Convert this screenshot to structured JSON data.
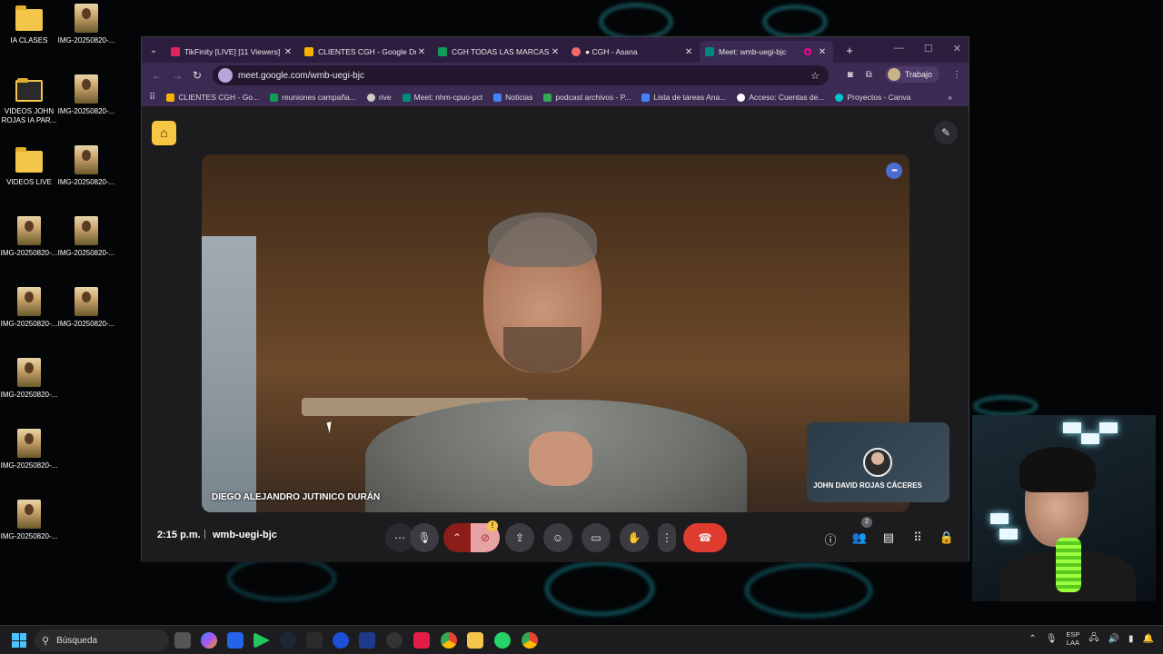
{
  "desktop": {
    "icons": [
      {
        "label": "IA CLASES",
        "type": "folder"
      },
      {
        "label": "IMG-20250820-...",
        "type": "image"
      },
      {
        "label": "VIDEOS JOHN ROJAS IA PAR...",
        "type": "folder-dark"
      },
      {
        "label": "IMG-20250820-...",
        "type": "image"
      },
      {
        "label": "VIDEOS LIVE",
        "type": "folder"
      },
      {
        "label": "IMG-20250820-...",
        "type": "image"
      },
      {
        "label": "IMG-20250820-...",
        "type": "image"
      },
      {
        "label": "IMG-20250820-...",
        "type": "image"
      },
      {
        "label": "IMG-20250820-...",
        "type": "image"
      },
      {
        "label": "IMG-20250820-...",
        "type": "image"
      },
      {
        "label": "IMG-20250820-...",
        "type": "image"
      },
      {
        "label": "IMG-20250820-...",
        "type": "image"
      },
      {
        "label": "IMG-20250820-...",
        "type": "image"
      }
    ]
  },
  "browser": {
    "tabs": [
      {
        "label": "TikFinity [LIVE] [11 Viewers]",
        "favicon_color": "#e0245e",
        "active": false
      },
      {
        "label": "CLIENTES CGH - Google Dri",
        "favicon_color": "#f4b400",
        "active": false
      },
      {
        "label": "CGH TODAS LAS MARCAS A",
        "favicon_color": "#0f9d58",
        "active": false
      },
      {
        "label": "● CGH - Asana",
        "favicon_color": "#f06a6a",
        "active": false
      },
      {
        "label": "Meet: wmb-uegi-bjc",
        "favicon_color": "#00897b",
        "active": true
      }
    ],
    "url": "meet.google.com/wmb-uegi-bjc",
    "profile_label": "Trabajo",
    "bookmarks": [
      {
        "label": "CLIENTES CGH - Go...",
        "color": "#f4b400"
      },
      {
        "label": "reuniones campaña...",
        "color": "#0f9d58"
      },
      {
        "label": "rive",
        "color": "#cccccc"
      },
      {
        "label": "Meet: nhm-cpuo-pct",
        "color": "#00897b"
      },
      {
        "label": "Noticias",
        "color": "#4285f4"
      },
      {
        "label": "podcast archivos - P...",
        "color": "#34a853"
      },
      {
        "label": "Lista de tareas Ana...",
        "color": "#4285f4"
      },
      {
        "label": "Acceso: Cuentas de...",
        "color": "#ffffff"
      },
      {
        "label": "Proyectos - Canva",
        "color": "#00c4cc"
      }
    ],
    "bookmarks_more": "»"
  },
  "meet": {
    "main_participant": "DIEGO ALEJANDRO JUTINICO DURÁN",
    "self_participant": "JOHN DAVID ROJAS CÁCERES",
    "time": "2:15 p.m.",
    "separator": "|",
    "code": "wmb-uegi-bjc",
    "people_count": "2",
    "camera_warning": "!"
  },
  "taskbar": {
    "search_placeholder": "Búsqueda",
    "lang_top": "ESP",
    "lang_bottom": "LAA"
  }
}
